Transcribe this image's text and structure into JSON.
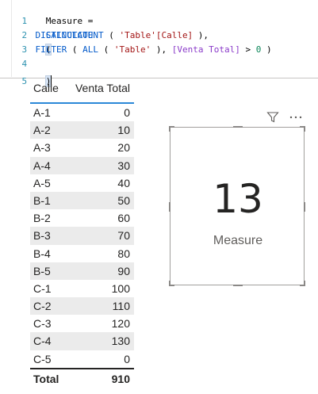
{
  "editor": {
    "line_numbers": [
      "1",
      "2",
      "3",
      "4",
      "5"
    ],
    "line1": "Measure =",
    "line2_kw": "CALCULATE",
    "line2_paren": "(",
    "line3_indent": "    ",
    "line3_fn": "DISTINCTCOUNT",
    "line3_open": " ( ",
    "line3_str": "'Table'[Calle]",
    "line3_close": " ),",
    "line4_indent": "    ",
    "line4_fn1": "FILTER",
    "line4_p1": " ( ",
    "line4_fn2": "ALL",
    "line4_p2": " ( ",
    "line4_str": "'Table'",
    "line4_p3": " ), ",
    "line4_meas": "[Venta Total]",
    "line4_op": " > ",
    "line4_num": "0",
    "line4_p4": " )",
    "line5": ")"
  },
  "table": {
    "columns": [
      "Calle",
      "Venta Total"
    ],
    "rows": [
      [
        "A-1",
        "0"
      ],
      [
        "A-2",
        "10"
      ],
      [
        "A-3",
        "20"
      ],
      [
        "A-4",
        "30"
      ],
      [
        "A-5",
        "40"
      ],
      [
        "B-1",
        "50"
      ],
      [
        "B-2",
        "60"
      ],
      [
        "B-3",
        "70"
      ],
      [
        "B-4",
        "80"
      ],
      [
        "B-5",
        "90"
      ],
      [
        "C-1",
        "100"
      ],
      [
        "C-2",
        "110"
      ],
      [
        "C-3",
        "120"
      ],
      [
        "C-4",
        "130"
      ],
      [
        "C-5",
        "0"
      ]
    ],
    "total_label": "Total",
    "total_value": "910",
    "accent_color": "#2b88d8"
  },
  "card": {
    "value": "13",
    "label": "Measure",
    "icons": [
      "filter-icon",
      "more-options-icon"
    ]
  }
}
